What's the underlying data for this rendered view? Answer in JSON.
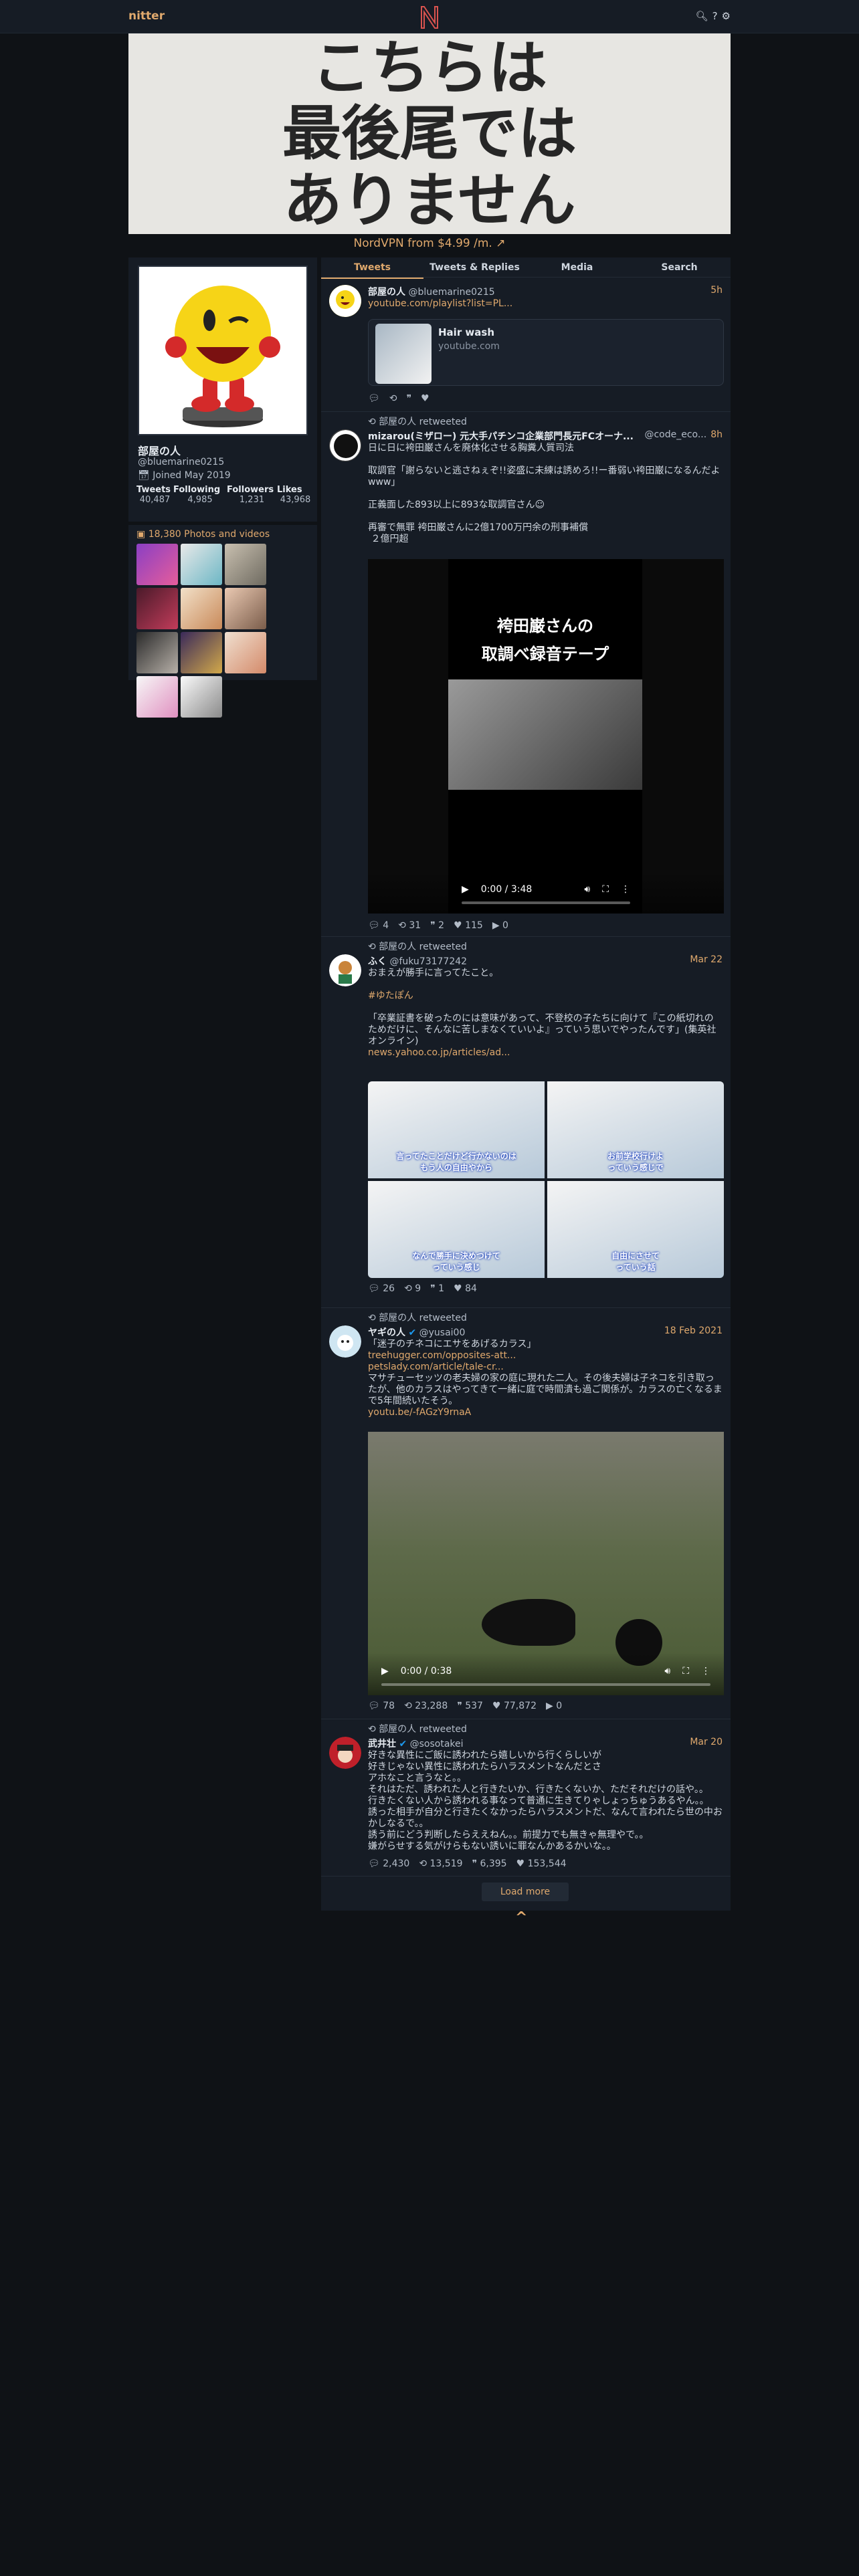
{
  "header": {
    "brand": "nitter",
    "logo_letter": "N",
    "icons": [
      "search-icon",
      "help-icon",
      "settings-icon"
    ],
    "accent": "#e0a96d"
  },
  "banner": {
    "lines": [
      "こちらは",
      "最後尾では",
      "ありません"
    ]
  },
  "ad": {
    "text": "NordVPN from $4.99 /m. ↗"
  },
  "profile": {
    "name": "部屋の人",
    "handle": "@bluemarine0215",
    "joined": "Joined May 2019",
    "stats": {
      "tweets_label": "Tweets",
      "tweets": "40,487",
      "following_label": "Following",
      "following": "4,985",
      "followers_label": "Followers",
      "followers": "1,231",
      "likes_label": "Likes",
      "likes": "43,968"
    }
  },
  "media": {
    "title": "18,380 Photos and videos"
  },
  "tabs": [
    "Tweets",
    "Tweets & Replies",
    "Media",
    "Search"
  ],
  "tweets": [
    {
      "name": "部屋の人",
      "handle": "@bluemarine0215",
      "date": "5h",
      "link": "youtube.com/playlist?list=PL...",
      "card_title": "Hair wash",
      "card_domain": "youtube.com",
      "stats": [
        "",
        "",
        "",
        ""
      ]
    },
    {
      "retweet": "部屋の人 retweeted",
      "name": "mizarou(ミザロー) 元大手パチンコ企業部門長元FCオーナ...",
      "handle": "@code_eco...",
      "date": "8h",
      "text": "日に日に袴田巌さんを廃体化させる胸糞人質司法\n\n取調官「謝らないと逃さねぇぞ!!姿盛に未練は誘めろ!!ー番弱い袴田巌になるんだよwww」\n\n正義面した893以上に893な取調官さん☺\n\n再審で無罪 袴田巌さんに2億1700万円余の刑事補償\n ２億円超",
      "video_title": [
        "袴田巌さんの",
        "取調べ録音テープ"
      ],
      "video_time": "0:00 / 3:48",
      "stats": [
        "4",
        "31",
        "2",
        "115",
        "0"
      ]
    },
    {
      "retweet": "部屋の人 retweeted",
      "name": "ふく",
      "handle": "@fuku73177242",
      "date": "Mar 22",
      "text": "おまえが勝手に言ってたこと。",
      "hashtag": "#ゆたぽん",
      "text2": "「卒業証書を破ったのには意味があって、不登校の子たちに向けて『この紙切れのためだけに、そんなに苦しまなくていいよ』っていう思いでやったんです」(集英社オンライン)",
      "link": "news.yahoo.co.jp/articles/ad...",
      "captions": [
        "言ってたことだけど行かないのは\nもう人の自由やから",
        "お前学校行けよ\nっていう感じで",
        "なんで勝手に決めつけて\nっていう感じ",
        "自由にさせて\nっていう話"
      ],
      "stats": [
        "26",
        "9",
        "1",
        "84"
      ]
    },
    {
      "retweet": "部屋の人 retweeted",
      "name": "ヤギの人",
      "handle": "@yusai00",
      "date": "18 Feb 2021",
      "text": "「迷子のチネコにエサをあげるカラス」",
      "links": [
        "treehugger.com/opposites-att...",
        "petslady.com/article/tale-cr..."
      ],
      "text2": "マサチューセッツの老夫婦の家の庭に現れた二人。その後夫婦は子ネコを引き取ったが、他のカラスはやってきて一緒に庭で時間潰も過ご関係が。カラスの亡くなるまで5年間続いたそう。",
      "link3": "youtu.be/-fAGzY9rnaA",
      "video_time": "0:00 / 0:38",
      "stats": [
        "78",
        "23,288",
        "537",
        "77,872",
        "0"
      ]
    },
    {
      "retweet": "部屋の人 retweeted",
      "name": "武井壮",
      "handle": "@sosotakei",
      "date": "Mar 20",
      "text": "好きな異性にご飯に誘われたら嬉しいから行くらしいが\n好きじゃない異性に誘われたらハラスメントなんだとさ\nアホなこと言うなと。。\nそれはただ、誘われた人と行きたいか、行きたくないか、ただそれだけの話や。。\n行きたくない人から誘われる事なって普通に生きてりゃしょっちゅうあるやん。。\n誘った相手が自分と行きたくなかったらハラスメントだ、なんて言われたら世の中おかしなるで。。\n誘う前にどう判断したらええねん。。前提力でも無きゃ無理やで。。\n嫌がらせする気がけらもない誘いに罪なんかあるかいな。。",
      "stats": [
        "2,430",
        "13,519",
        "6,395",
        "153,544"
      ]
    }
  ],
  "footer": {
    "load_more": "Load more",
    "scroll_top": "^"
  }
}
